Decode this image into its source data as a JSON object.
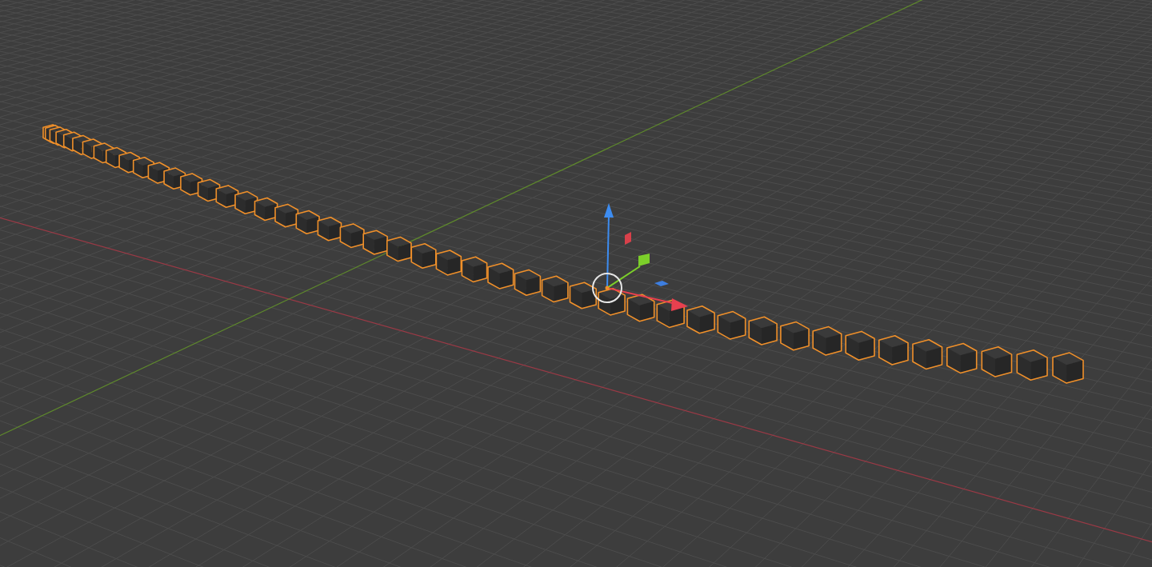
{
  "viewport": {
    "objects": [
      {
        "selected": true
      },
      {
        "selected": true
      },
      {
        "selected": true
      },
      {
        "selected": true
      },
      {
        "selected": true
      },
      {
        "selected": true
      },
      {
        "selected": true
      },
      {
        "selected": true
      },
      {
        "selected": true
      },
      {
        "selected": true
      },
      {
        "selected": true
      },
      {
        "selected": true
      },
      {
        "selected": true
      },
      {
        "selected": true
      },
      {
        "selected": true
      },
      {
        "selected": true
      },
      {
        "selected": true
      },
      {
        "selected": true
      },
      {
        "selected": true
      },
      {
        "selected": true
      },
      {
        "selected": true
      },
      {
        "selected": true
      },
      {
        "selected": true
      },
      {
        "selected": true
      },
      {
        "selected": true
      },
      {
        "selected": true
      },
      {
        "selected": true
      },
      {
        "selected": true
      },
      {
        "selected": true
      },
      {
        "selected": true
      },
      {
        "selected": true
      },
      {
        "selected": true
      },
      {
        "selected": true
      },
      {
        "selected": true
      },
      {
        "selected": true
      },
      {
        "selected": true
      },
      {
        "selected": true
      },
      {
        "selected": true
      },
      {
        "selected": true
      },
      {
        "selected": true
      },
      {
        "selected": true
      },
      {
        "selected": true
      },
      {
        "selected": true
      },
      {
        "selected": true
      },
      {
        "selected": true
      },
      {
        "selected": true
      }
    ]
  }
}
